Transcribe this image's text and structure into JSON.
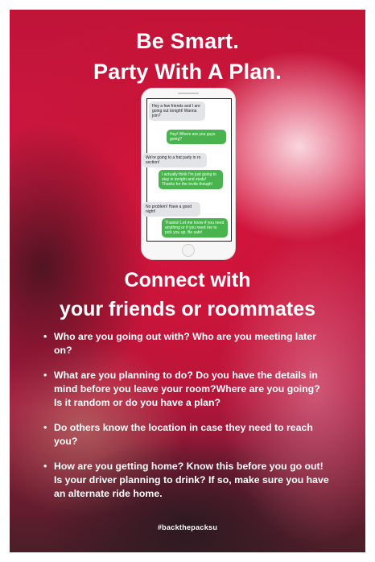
{
  "headline": {
    "line1": "Be Smart.",
    "line2": "Party With A Plan."
  },
  "phone": {
    "messages": [
      {
        "side": "incoming",
        "text": "Hey a few friends and I are going out tonight! Wanna join?"
      },
      {
        "side": "outgoing",
        "text": "Hey! Where are you guys going?"
      },
      {
        "side": "incoming",
        "text": "We're going to a frat party in ro section!"
      },
      {
        "side": "outgoing",
        "text": "I actually think I'm just going to stay in tonight and study! Thanks for the invite though!"
      },
      {
        "side": "incoming",
        "text": "No problem! Have a good night!"
      },
      {
        "side": "outgoing",
        "text": "Thanks! Let me know if you need anything or if you need me to pick you up. Be safe!"
      }
    ]
  },
  "subhead": {
    "line1": "Connect with",
    "line2": "your friends or roommates"
  },
  "bullets": {
    "marker": "•",
    "items": [
      "Who are you going out with? Who are you meeting later on?",
      "What are you planning to do? Do you have the details in mind before you leave your room?Where are you going? Is it random or do you have a plan?",
      "Do others know the location in case they need to reach you?",
      "How are you getting home? Know this before you go out! Is your driver planning to drink? If so, make sure you have an alternate ride home."
    ]
  },
  "hashtag": "#backthepacksu",
  "colors": {
    "background": "#c8163f",
    "bubble_incoming": "#e3e4e8",
    "bubble_outgoing": "#49b34d",
    "text": "#ffffff"
  }
}
